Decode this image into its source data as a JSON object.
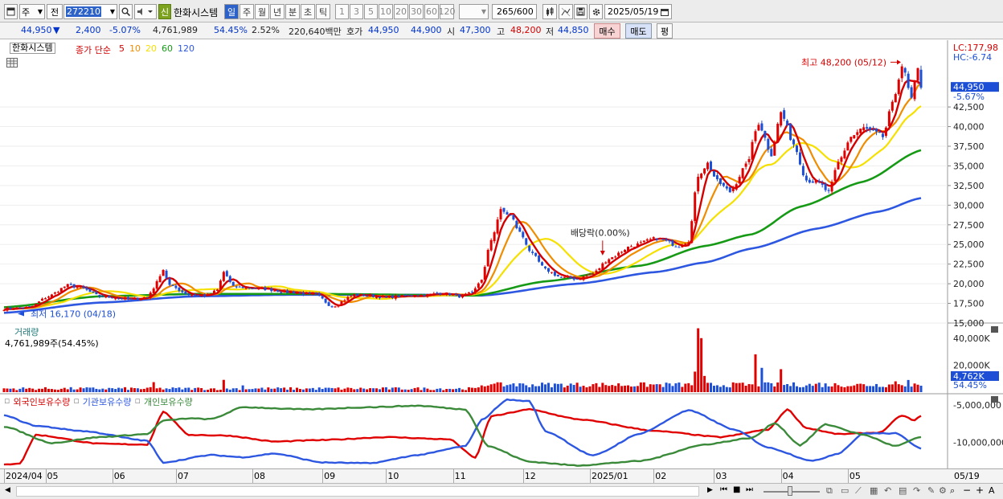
{
  "toolbar": {
    "market": "주",
    "prev": "전",
    "code": "272210",
    "badge": "신",
    "stock_name": "한화시스템",
    "periods": [
      "일",
      "주",
      "월",
      "년",
      "분",
      "초",
      "틱"
    ],
    "intervals": [
      "1",
      "3",
      "5",
      "10",
      "20",
      "30",
      "60",
      "120"
    ],
    "count": "265",
    "count_max": "/600",
    "date": "2025/05/19"
  },
  "quote": {
    "price": "44,950",
    "change": "2,400",
    "change_pct": "-5.07%",
    "volume": "4,761,989",
    "volume_ratio": "54.45%",
    "turnover": "2.52%",
    "amount": "220,640백만",
    "bid_label": "호가",
    "ask": "44,950",
    "bid": "44,900",
    "open_label": "시",
    "open": "47,300",
    "high_label": "고",
    "high": "48,200",
    "low_label": "저",
    "low": "44,850",
    "buy": "매수",
    "sell": "매도",
    "avg": "평"
  },
  "price_panel": {
    "name": "한화시스템",
    "ma_label": "종가 단순",
    "ma_periods": [
      "5",
      "10",
      "20",
      "60",
      "120"
    ],
    "ma_colors": [
      "#d40000",
      "#f08c00",
      "#f5e000",
      "#169a16",
      "#2d57e0"
    ],
    "lc": "LC:177,98",
    "hc": "HC:-6.74",
    "current": "44,950",
    "current_pct": "-5.67%",
    "high_note": "최고 48,200 (05/12)",
    "low_note": "최저 16,170 (04/18)",
    "dividend_note": "배당락(0.00%)"
  },
  "volume_panel": {
    "title": "거래량",
    "value": "4,761,989주(54.45%)",
    "current": "4,762K",
    "current_pct": "54.45%"
  },
  "holding_panel": {
    "series": [
      {
        "name": "외국인보유수량",
        "color": "#d40000"
      },
      {
        "name": "기관보유수량",
        "color": "#2d57e0"
      },
      {
        "name": "개인보유수량",
        "color": "#3a8a3a"
      }
    ]
  },
  "x_labels": [
    "2024/04",
    "05",
    "06",
    "07",
    "08",
    "09",
    "10",
    "11",
    "12",
    "2025/01",
    "02",
    "03",
    "04",
    "05"
  ],
  "x_right_label": "05/19",
  "chart_data": [
    {
      "type": "candlestick",
      "title": "한화시스템",
      "x": [
        "2024/04",
        "05",
        "06",
        "07",
        "08",
        "09",
        "10",
        "11",
        "12",
        "2025/01",
        "02",
        "03",
        "04",
        "05"
      ],
      "ylim": [
        15000,
        51000
      ],
      "y_ticks": [
        "15,000",
        "17,500",
        "20,000",
        "22,500",
        "25,000",
        "27,500",
        "30,000",
        "32,500",
        "35,000",
        "37,500",
        "40,000",
        "42,500"
      ],
      "close_anchors": [
        [
          0,
          16800
        ],
        [
          8,
          17000
        ],
        [
          14,
          18400
        ],
        [
          20,
          19800
        ],
        [
          24,
          19500
        ],
        [
          30,
          18400
        ],
        [
          40,
          18000
        ],
        [
          45,
          18300
        ],
        [
          47,
          19500
        ],
        [
          50,
          21800
        ],
        [
          52,
          19800
        ],
        [
          58,
          18600
        ],
        [
          64,
          18500
        ],
        [
          67,
          19200
        ],
        [
          69,
          21500
        ],
        [
          72,
          19600
        ],
        [
          80,
          19400
        ],
        [
          90,
          18900
        ],
        [
          98,
          18600
        ],
        [
          103,
          17100
        ],
        [
          110,
          18600
        ],
        [
          120,
          18300
        ],
        [
          130,
          18500
        ],
        [
          138,
          18800
        ],
        [
          143,
          18400
        ],
        [
          147,
          18800
        ],
        [
          150,
          20600
        ],
        [
          153,
          25600
        ],
        [
          156,
          29300
        ],
        [
          159,
          28700
        ],
        [
          162,
          26500
        ],
        [
          166,
          23700
        ],
        [
          170,
          21800
        ],
        [
          175,
          20800
        ],
        [
          180,
          20600
        ],
        [
          185,
          21300
        ],
        [
          190,
          23200
        ],
        [
          197,
          24800
        ],
        [
          205,
          25800
        ],
        [
          212,
          24800
        ],
        [
          215,
          25500
        ],
        [
          218,
          33800
        ],
        [
          221,
          35300
        ],
        [
          224,
          33000
        ],
        [
          228,
          31700
        ],
        [
          233,
          35000
        ],
        [
          237,
          40500
        ],
        [
          241,
          36500
        ],
        [
          244,
          41800
        ],
        [
          248,
          37800
        ],
        [
          252,
          33200
        ],
        [
          256,
          32800
        ],
        [
          259,
          31600
        ],
        [
          262,
          35400
        ],
        [
          266,
          38700
        ],
        [
          270,
          39800
        ],
        [
          273,
          39300
        ],
        [
          276,
          38700
        ],
        [
          279,
          42800
        ],
        [
          282,
          47800
        ],
        [
          285,
          43500
        ],
        [
          287,
          47200
        ],
        [
          288,
          44950
        ]
      ],
      "moving_averages": [
        {
          "name": "5",
          "color": "#d40000"
        },
        {
          "name": "10",
          "color": "#f08c00"
        },
        {
          "name": "20",
          "color": "#f5e000"
        },
        {
          "name": "60",
          "color": "#169a16"
        },
        {
          "name": "120",
          "color": "#2d57e0"
        }
      ],
      "ma120_anchors": [
        [
          0,
          16300
        ],
        [
          30,
          17600
        ],
        [
          60,
          18400
        ],
        [
          90,
          18600
        ],
        [
          130,
          18600
        ],
        [
          150,
          18500
        ],
        [
          180,
          20000
        ],
        [
          205,
          21500
        ],
        [
          220,
          22700
        ],
        [
          235,
          24500
        ],
        [
          255,
          27000
        ],
        [
          275,
          29200
        ],
        [
          288,
          30900
        ]
      ],
      "ma60_anchors": [
        [
          0,
          17000
        ],
        [
          30,
          18400
        ],
        [
          60,
          18700
        ],
        [
          100,
          18700
        ],
        [
          148,
          18500
        ],
        [
          170,
          20300
        ],
        [
          200,
          22300
        ],
        [
          220,
          24800
        ],
        [
          235,
          26300
        ],
        [
          250,
          29800
        ],
        [
          270,
          33000
        ],
        [
          288,
          37000
        ]
      ],
      "annotations": [
        "최고 48,200 (05/12)",
        "최저 16,170 (04/18)",
        "배당락(0.00%)"
      ]
    },
    {
      "type": "bar",
      "title": "거래량",
      "ylim": [
        0,
        50000000
      ],
      "y_ticks": [
        "20,000K",
        "40,000K"
      ],
      "spikes": [
        [
          47,
          7400000
        ],
        [
          69,
          9100000
        ],
        [
          75,
          5000000
        ],
        [
          153,
          5800000
        ],
        [
          156,
          7200000
        ],
        [
          160,
          6500000
        ],
        [
          217,
          15200000
        ],
        [
          218,
          47300000
        ],
        [
          219,
          40000000
        ],
        [
          220,
          12000000
        ],
        [
          236,
          28000000
        ],
        [
          238,
          18000000
        ],
        [
          244,
          17000000
        ],
        [
          256,
          7000000
        ],
        [
          280,
          8000000
        ],
        [
          284,
          9000000
        ],
        [
          288,
          4762000
        ]
      ]
    },
    {
      "type": "line",
      "title": "보유수량",
      "ylim": [
        -13500000,
        -3500000
      ],
      "y_ticks": [
        "-5,000,000",
        "-10,000,000"
      ],
      "series": [
        {
          "name": "외국인보유수량",
          "anchors": [
            [
              0,
              -13000000
            ],
            [
              5,
              -12800000
            ],
            [
              10,
              -9000000
            ],
            [
              30,
              -10200000
            ],
            [
              45,
              -10300000
            ],
            [
              50,
              -5900000
            ],
            [
              58,
              -9000000
            ],
            [
              70,
              -9100000
            ],
            [
              85,
              -9900000
            ],
            [
              100,
              -9700000
            ],
            [
              120,
              -9300000
            ],
            [
              140,
              -9600000
            ],
            [
              148,
              -12100000
            ],
            [
              153,
              -6500000
            ],
            [
              165,
              -5600000
            ],
            [
              180,
              -6900000
            ],
            [
              205,
              -8500000
            ],
            [
              225,
              -9300000
            ],
            [
              240,
              -8300000
            ],
            [
              246,
              -5600000
            ],
            [
              252,
              -8100000
            ],
            [
              262,
              -8900000
            ],
            [
              275,
              -8700000
            ],
            [
              282,
              -6400000
            ],
            [
              286,
              -7100000
            ],
            [
              288,
              -6400000
            ]
          ]
        },
        {
          "name": "기관보유수량",
          "anchors": [
            [
              0,
              -6400000
            ],
            [
              10,
              -7800000
            ],
            [
              25,
              -8500000
            ],
            [
              45,
              -9800000
            ],
            [
              50,
              -12700000
            ],
            [
              65,
              -11700000
            ],
            [
              75,
              -12000000
            ],
            [
              85,
              -11500000
            ],
            [
              100,
              -12700000
            ],
            [
              115,
              -12800000
            ],
            [
              130,
              -11700000
            ],
            [
              145,
              -10500000
            ],
            [
              150,
              -7000000
            ],
            [
              158,
              -4300000
            ],
            [
              165,
              -4500000
            ],
            [
              170,
              -8500000
            ],
            [
              185,
              -11800000
            ],
            [
              200,
              -8800000
            ],
            [
              215,
              -5700000
            ],
            [
              230,
              -8400000
            ],
            [
              240,
              -10700000
            ],
            [
              254,
              -12500000
            ],
            [
              262,
              -11500000
            ],
            [
              270,
              -8800000
            ],
            [
              280,
              -8800000
            ],
            [
              288,
              -10800000
            ]
          ]
        },
        {
          "name": "개인보유수량",
          "anchors": [
            [
              0,
              -7900000
            ],
            [
              15,
              -10100000
            ],
            [
              30,
              -9300000
            ],
            [
              45,
              -8900000
            ],
            [
              50,
              -7100000
            ],
            [
              58,
              -6800000
            ],
            [
              65,
              -6900000
            ],
            [
              75,
              -5300000
            ],
            [
              95,
              -5600000
            ],
            [
              115,
              -5300000
            ],
            [
              130,
              -5100000
            ],
            [
              145,
              -5600000
            ],
            [
              152,
              -10500000
            ],
            [
              165,
              -12600000
            ],
            [
              180,
              -13100000
            ],
            [
              200,
              -12500000
            ],
            [
              220,
              -10300000
            ],
            [
              235,
              -9400000
            ],
            [
              242,
              -7400000
            ],
            [
              250,
              -10400000
            ],
            [
              258,
              -7600000
            ],
            [
              270,
              -9000000
            ],
            [
              280,
              -10500000
            ],
            [
              288,
              -9300000
            ]
          ]
        }
      ]
    }
  ]
}
